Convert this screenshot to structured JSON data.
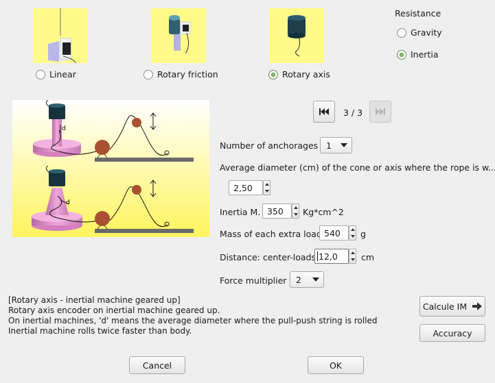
{
  "modes": [
    {
      "label": "Linear",
      "selected": false,
      "icon": "linear-encoder-icon"
    },
    {
      "label": "Rotary friction",
      "selected": false,
      "icon": "rotary-friction-encoder-icon"
    },
    {
      "label": "Rotary axis",
      "selected": true,
      "icon": "rotary-axis-encoder-icon"
    }
  ],
  "resistance": {
    "title": "Resistance",
    "options": [
      {
        "label": "Gravity",
        "selected": false
      },
      {
        "label": "Inertia",
        "selected": true
      }
    ]
  },
  "pager": {
    "text": "3 / 3"
  },
  "form": {
    "anchorages_label": "Number of anchorages",
    "anchorages_value": "1",
    "diameter_label": "Average diameter (cm) of the cone or axis where the rope is w...",
    "diameter_value": "2,50",
    "inertia_label": "Inertia M.",
    "inertia_value": "350",
    "inertia_unit": "Kg*cm^2",
    "mass_label": "Mass of each extra load",
    "mass_value": "540",
    "mass_unit": "g",
    "distance_label": "Distance: center-loads",
    "distance_value": "12,0",
    "distance_unit": "cm",
    "force_label": "Force multiplier",
    "force_value": "2"
  },
  "illustration": {
    "label_d": "d"
  },
  "description": [
    "[Rotary axis - inertial machine geared up]",
    "Rotary axis encoder on inertial machine geared up.",
    "On inertial machines, 'd' means the average diameter where the pull-push string is rolled",
    "Inertial machine rolls twice faster than body."
  ],
  "buttons": {
    "calcule": "Calcule IM",
    "accuracy": "Accuracy",
    "cancel": "Cancel",
    "ok": "OK"
  },
  "colors": {
    "thumb_bg": "#fffa8a",
    "radio_selected": "#8dc073",
    "machine_pink": "#e99ad4",
    "ball": "#a8502f"
  }
}
